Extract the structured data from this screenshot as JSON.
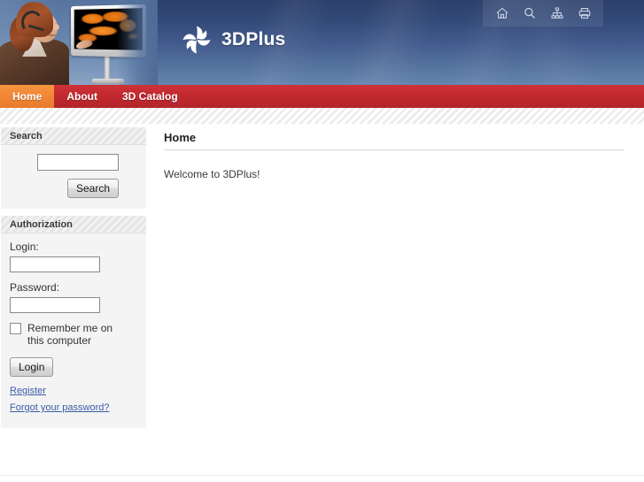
{
  "site": {
    "brand_name": "3DPlus",
    "brand_logo_icon": "swirl-logo-icon"
  },
  "header": {
    "icon_bar": [
      {
        "name": "home-icon",
        "title": "Home"
      },
      {
        "name": "search-icon",
        "title": "Search"
      },
      {
        "name": "sitemap-icon",
        "title": "Site map"
      },
      {
        "name": "print-icon",
        "title": "Print"
      }
    ],
    "hero_alt": "Woman with headset beside a monitor showing a 3D orange snake"
  },
  "nav": {
    "items": [
      {
        "label": "Home",
        "active": true
      },
      {
        "label": "About",
        "active": false
      },
      {
        "label": "3D Catalog",
        "active": false
      }
    ]
  },
  "sidebar": {
    "search_panel": {
      "title": "Search",
      "input_value": "",
      "input_placeholder": "",
      "button_label": "Search"
    },
    "auth_panel": {
      "title": "Authorization",
      "login_label": "Login:",
      "login_value": "",
      "password_label": "Password:",
      "password_value": "",
      "remember_label": "Remember me on this computer",
      "remember_checked": false,
      "login_button_label": "Login",
      "links": [
        {
          "label": "Register"
        },
        {
          "label": "Forgot your password?"
        }
      ]
    }
  },
  "main": {
    "title": "Home",
    "body_text": "Welcome to 3DPlus!"
  },
  "colors": {
    "header_gradient_top": "#2b3f6b",
    "header_gradient_bottom": "#6484ae",
    "nav_red": "#c22a2f",
    "nav_active_orange": "#f08636",
    "link_blue": "#3b5ca8",
    "panel_bg": "#f4f4f4"
  }
}
